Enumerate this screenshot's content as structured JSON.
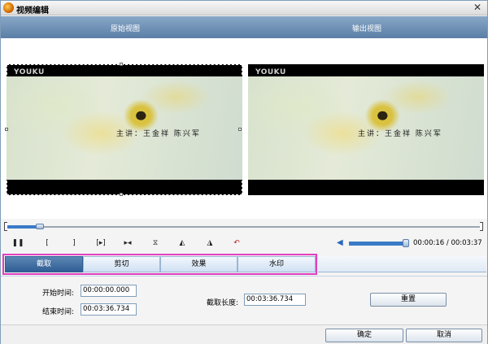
{
  "window": {
    "title": "视频编辑",
    "close_glyph": "✕",
    "icon": "app-logo-icon"
  },
  "views": {
    "original_label": "原始视图",
    "output_label": "输出视图"
  },
  "preview": {
    "watermark_logo": "YOUKU",
    "subtitle": "主讲：王金祥  陈兴军"
  },
  "timeline": {
    "progress": 0.072
  },
  "controls": {
    "pause": "❚❚",
    "mark_in": "[",
    "mark_out": "]",
    "play_selection": "[▸]",
    "step": "▸◂",
    "flip_vertical": "⧖",
    "rotate_left": "◭",
    "rotate_right": "◮",
    "undo": "↶",
    "volume_level": 1.0,
    "time_current": "00:00:16",
    "time_separator": " / ",
    "time_total": "00:03:37"
  },
  "tabs": [
    {
      "label": "截取",
      "active": true
    },
    {
      "label": "剪切",
      "active": false
    },
    {
      "label": "效果",
      "active": false
    },
    {
      "label": "水印",
      "active": false
    }
  ],
  "trim": {
    "start_label": "开始时间:",
    "start_value": "00:00:00.000",
    "end_label": "结束时间:",
    "end_value": "00:03:36.734",
    "length_label": "截取长度:",
    "length_value": "00:03:36.734",
    "reset_label": "重置"
  },
  "footer": {
    "ok_label": "确定",
    "cancel_label": "取消"
  },
  "colors": {
    "tab_active": "#2f5d93",
    "highlight_border": "#e040c0",
    "slider_fill": "#3a7ac8"
  }
}
